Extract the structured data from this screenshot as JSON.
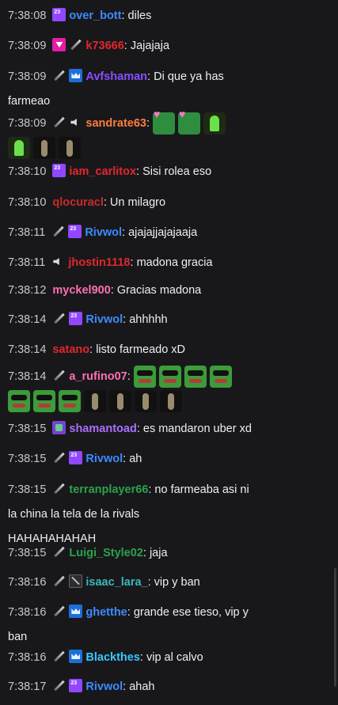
{
  "messages": [
    {
      "time": "7:38:08",
      "badges": [
        "sub"
      ],
      "user": "over_bott",
      "color": "#3b8bff",
      "text": "diles"
    },
    {
      "time": "7:38:09",
      "badges": [
        "prime",
        "sword"
      ],
      "user": "k73666",
      "color": "#e5252d",
      "text": "Jajajaja"
    },
    {
      "time": "7:38:09",
      "badges": [
        "sword",
        "vip"
      ],
      "user": "Avfshaman",
      "color": "#8a4dff",
      "text": "Di que ya has",
      "text2": "farmeao"
    },
    {
      "time": "7:38:09",
      "badges": [
        "sword",
        "mute"
      ],
      "user": "sandrate63",
      "color": "#ff7b3b",
      "text": "",
      "emotes": [
        "heart",
        "heart",
        "hand"
      ],
      "emotes2": [
        "hand",
        "dance",
        "dance"
      ]
    },
    {
      "time": "7:38:10",
      "badges": [
        "sub"
      ],
      "user": "iam_carlitox",
      "color": "#e5252d",
      "text": "Sisi rolea eso"
    },
    {
      "time": "7:38:10",
      "badges": [],
      "user": "qlocuracl",
      "color": "#c92b2b",
      "text": "Un milagro"
    },
    {
      "time": "7:38:11",
      "badges": [
        "sword",
        "sub"
      ],
      "user": "Rivwol",
      "color": "#3b8bff",
      "text": "ajajajjajajaaja"
    },
    {
      "time": "7:38:11",
      "badges": [
        "mute"
      ],
      "user": "jhostin1118",
      "color": "#e5252d",
      "text": "madona gracia"
    },
    {
      "time": "7:38:12",
      "badges": [],
      "user": "myckel900",
      "color": "#ff6fb5",
      "text": "Gracias madona"
    },
    {
      "time": "7:38:14",
      "badges": [
        "sword",
        "sub"
      ],
      "user": "Rivwol",
      "color": "#3b8bff",
      "text": "ahhhhh"
    },
    {
      "time": "7:38:14",
      "badges": [],
      "user": "satano",
      "color": "#e5252d",
      "text": "listo farmeado xD"
    },
    {
      "time": "7:38:14",
      "badges": [
        "sword"
      ],
      "user": "a_rufino07",
      "color": "#ff6fb5",
      "text": "",
      "emotes": [
        "frog",
        "frog",
        "frog",
        "frog"
      ],
      "emotes2": [
        "frog",
        "frog",
        "frog",
        "dance",
        "dance",
        "dance",
        "dance"
      ]
    },
    {
      "time": "7:38:15",
      "badges": [
        "bits"
      ],
      "user": "shamantoad",
      "color": "#a970ff",
      "text": "es mandaron uber xd"
    },
    {
      "time": "7:38:15",
      "badges": [
        "sword",
        "sub"
      ],
      "user": "Rivwol",
      "color": "#3b8bff",
      "text": "ah"
    },
    {
      "time": "7:38:15",
      "badges": [
        "sword"
      ],
      "user": "terranplayer66",
      "color": "#2aa34a",
      "text": "no farmeaba asi ni",
      "text2": "la china la tela de la rivals",
      "text3": "HAHAHAHAHAH"
    },
    {
      "time": "7:38:15",
      "badges": [
        "sword"
      ],
      "user": "Luigi_Style02",
      "color": "#2aa34a",
      "text": "jaja"
    },
    {
      "time": "7:38:16",
      "badges": [
        "sword",
        "noaudio"
      ],
      "user": "isaac_lara_",
      "color": "#3bb8b8",
      "text": "vip y ban"
    },
    {
      "time": "7:38:16",
      "badges": [
        "sword",
        "vip"
      ],
      "user": "ghetthe",
      "color": "#3b8bff",
      "text": "grande ese tieso, vip y",
      "text2": "ban"
    },
    {
      "time": "7:38:16",
      "badges": [
        "sword",
        "vip"
      ],
      "user": "Blackthes",
      "color": "#39c6ff",
      "text": "vip al calvo"
    },
    {
      "time": "7:38:17",
      "badges": [
        "sword",
        "sub"
      ],
      "user": "Rivwol",
      "color": "#3b8bff",
      "text": "ahah"
    }
  ]
}
